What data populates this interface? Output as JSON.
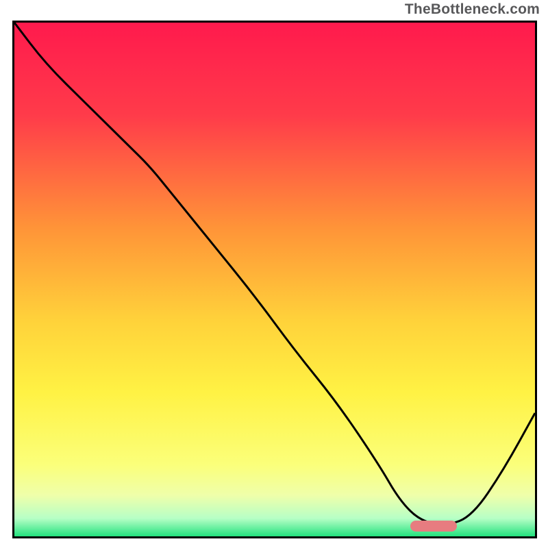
{
  "watermark": "TheBottleneck.com",
  "chart_data": {
    "type": "line",
    "title": "",
    "xlabel": "",
    "ylabel": "",
    "xlim": [
      0,
      100
    ],
    "ylim": [
      0,
      100
    ],
    "gradient_stops": [
      {
        "offset": 0.0,
        "color": "#ff1a4d"
      },
      {
        "offset": 0.18,
        "color": "#ff3b4a"
      },
      {
        "offset": 0.4,
        "color": "#ff9438"
      },
      {
        "offset": 0.58,
        "color": "#ffd23a"
      },
      {
        "offset": 0.72,
        "color": "#fff244"
      },
      {
        "offset": 0.86,
        "color": "#fbff7a"
      },
      {
        "offset": 0.92,
        "color": "#efffaa"
      },
      {
        "offset": 0.965,
        "color": "#b7ffc6"
      },
      {
        "offset": 1.0,
        "color": "#23e27e"
      }
    ],
    "series": [
      {
        "name": "bottleneck-curve",
        "x": [
          0,
          6,
          14,
          22,
          26,
          30,
          38,
          46,
          54,
          62,
          70,
          74,
          78,
          83,
          88,
          94,
          100
        ],
        "y": [
          100,
          92,
          84,
          76,
          72,
          67,
          57,
          47,
          36,
          26,
          14,
          7,
          3,
          2,
          4,
          13,
          24
        ]
      }
    ],
    "marker": {
      "x_start": 76,
      "x_end": 85,
      "y": 2,
      "color": "#e77c80",
      "height_pct": 2.1
    }
  }
}
